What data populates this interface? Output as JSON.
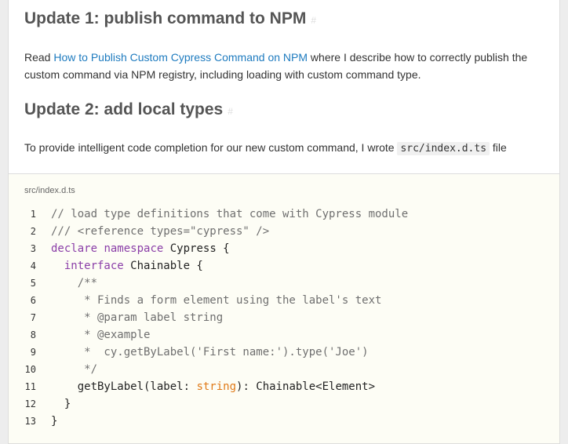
{
  "sections": [
    {
      "heading": "Update 1: publish command to NPM",
      "anchor": "#",
      "paragraph": {
        "before": "Read ",
        "link_text": "How to Publish Custom Cypress Command on NPM",
        "after": " where I describe how to correctly publish the custom command via NPM registry, including loading with custom command type."
      }
    },
    {
      "heading": "Update 2: add local types",
      "anchor": "#",
      "paragraph": {
        "before": "To provide intelligent code completion for our new custom command, I wrote ",
        "code": "src/index.d.ts",
        "after": " file"
      }
    }
  ],
  "code_block": {
    "filename": "src/index.d.ts",
    "lines": [
      {
        "n": "1",
        "tokens": [
          {
            "t": "// load type definitions that come with Cypress module",
            "c": "cm"
          }
        ]
      },
      {
        "n": "2",
        "tokens": [
          {
            "t": "/// <reference types=\"cypress\" />",
            "c": "cm"
          }
        ]
      },
      {
        "n": "3",
        "tokens": [
          {
            "t": "declare",
            "c": "kw"
          },
          {
            "t": " ",
            "c": "pl"
          },
          {
            "t": "namespace",
            "c": "kw"
          },
          {
            "t": " Cypress {",
            "c": "pl"
          }
        ]
      },
      {
        "n": "4",
        "tokens": [
          {
            "t": "  ",
            "c": "pl"
          },
          {
            "t": "interface",
            "c": "kw"
          },
          {
            "t": " Chainable {",
            "c": "pl"
          }
        ]
      },
      {
        "n": "5",
        "tokens": [
          {
            "t": "    /**",
            "c": "cm"
          }
        ]
      },
      {
        "n": "6",
        "tokens": [
          {
            "t": "     * Finds a form element using the label's text",
            "c": "cm"
          }
        ]
      },
      {
        "n": "7",
        "tokens": [
          {
            "t": "     * @param label string",
            "c": "cm"
          }
        ]
      },
      {
        "n": "8",
        "tokens": [
          {
            "t": "     * @example",
            "c": "cm"
          }
        ]
      },
      {
        "n": "9",
        "tokens": [
          {
            "t": "     *  cy.getByLabel('First name:').type('Joe')",
            "c": "cm"
          }
        ]
      },
      {
        "n": "10",
        "tokens": [
          {
            "t": "     */",
            "c": "cm"
          }
        ]
      },
      {
        "n": "11",
        "tokens": [
          {
            "t": "    getByLabel(label: ",
            "c": "pl"
          },
          {
            "t": "string",
            "c": "ty"
          },
          {
            "t": "): Chainable<Element>",
            "c": "pl"
          }
        ]
      },
      {
        "n": "12",
        "tokens": [
          {
            "t": "  }",
            "c": "pl"
          }
        ]
      },
      {
        "n": "13",
        "tokens": [
          {
            "t": "}",
            "c": "pl"
          }
        ]
      }
    ]
  }
}
